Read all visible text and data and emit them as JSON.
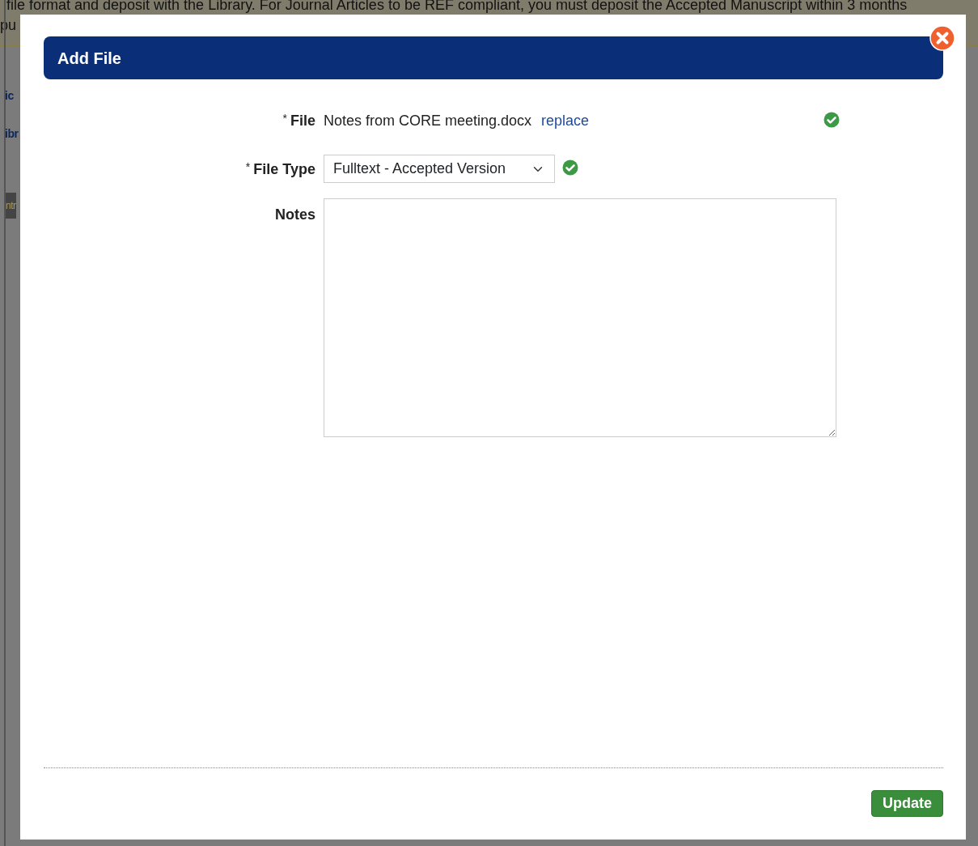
{
  "background": {
    "notice_lines": [
      "file format and deposit with the Library. For Journal Articles to be REF compliant, you must deposit the Accepted Manuscript within 3 months",
      "pu"
    ],
    "fragments": [
      {
        "kind": "link",
        "text": "ic"
      },
      {
        "kind": "link",
        "text": "ibr"
      },
      {
        "kind": "tab",
        "text": "ntr"
      }
    ]
  },
  "dialog": {
    "title": "Add File",
    "fields": [
      {
        "kind": "file",
        "required_mark": "*",
        "label": "File",
        "value": "Notes from CORE meeting.docx",
        "link": "replace",
        "valid": true
      },
      {
        "kind": "select",
        "required_mark": "*",
        "label": "File Type",
        "value": "Fulltext - Accepted Version",
        "valid": true
      },
      {
        "kind": "textarea",
        "label": "Notes"
      }
    ],
    "buttons": [
      "Update"
    ]
  }
}
